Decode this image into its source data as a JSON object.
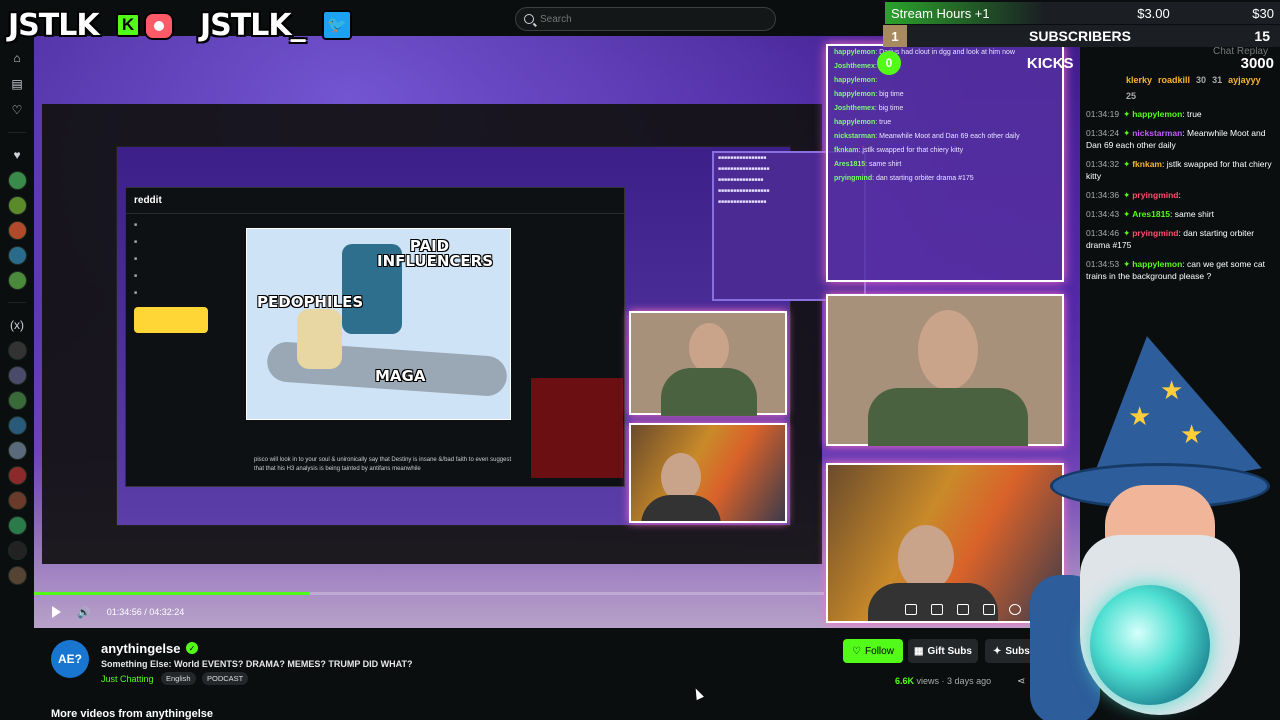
{
  "overlay": {
    "brand_left": "JSTLK",
    "brand_kick_letter": "K",
    "brand_right": "JSTLK_",
    "stream_hours_label": "Stream Hours +1",
    "stream_amount": "$3.00",
    "stream_goal": "$30",
    "subscribers_rank": "1",
    "subscribers_label": "SUBSCRIBERS",
    "subscribers_value": "15",
    "kicks_rank": "0",
    "kicks_label": "KICKS",
    "kicks_value": "3000"
  },
  "search": {
    "placeholder": "Search"
  },
  "sidebar": {
    "icons": [
      "home-icon",
      "browse-icon",
      "following-icon",
      "heart-icon"
    ],
    "avatars": [
      "a1",
      "a2",
      "a3",
      "a4",
      "a5",
      "a6",
      "a7",
      "a8",
      "a9",
      "a10",
      "a11",
      "a12",
      "a13",
      "a14",
      "a15",
      "a16"
    ]
  },
  "embedded": {
    "reddit_logo": "reddit",
    "meme_labels": [
      "PAID INFLUENCERS",
      "PEDOPHILES",
      "MAGA"
    ],
    "caption": "pisco will look in to your soul & unironically say that Destiny is insane &/bad faith to even suggest that that his H3 analysis is being tainted by antifans meanwhile"
  },
  "stream_chat": [
    {
      "user": "happylemon",
      "text": "Darius had clout in dgg and look at him now"
    },
    {
      "user": "Joshthemex",
      "text": ""
    },
    {
      "user": "happylemon",
      "text": ""
    },
    {
      "user": "happylemon",
      "text": "big time"
    },
    {
      "user": "Joshthemex",
      "text": "big time"
    },
    {
      "user": "happylemon",
      "text": "true"
    },
    {
      "user": "nickstarman",
      "text": "Meanwhile Moot and Dan 69 each other daily"
    },
    {
      "user": "fknkam",
      "text": "jstlk swapped for that chiery kitty"
    },
    {
      "user": "Ares1815",
      "text": "same shirt"
    },
    {
      "user": "pryingmind",
      "text": "dan starting orbiter drama #175"
    }
  ],
  "player": {
    "current_time": "01:34:56",
    "duration": "04:32:24",
    "progress_pct": 34.9
  },
  "right_chat": {
    "header": "Chat Replay",
    "leaders": [
      {
        "rank": "1",
        "name": "klerky",
        "name2": "roadkill",
        "n": "30"
      },
      {
        "rank": "",
        "name": "",
        "name2": "ayjayyy",
        "n": "25",
        "n1": "31"
      }
    ],
    "messages": [
      {
        "ts": "01:34:19",
        "user": "happylemon",
        "color": "#53fc18",
        "text": "true"
      },
      {
        "ts": "01:34:24",
        "user": "nickstarman",
        "color": "#c35bff",
        "text": "Meanwhile Moot and Dan 69 each other daily"
      },
      {
        "ts": "01:34:32",
        "user": "fknkam",
        "color": "#f6b42f",
        "text": "jstlk swapped for that chiery kitty"
      },
      {
        "ts": "01:34:36",
        "user": "pryingmind",
        "color": "#ff4d6d",
        "text": ""
      },
      {
        "ts": "01:34:43",
        "user": "Ares1815",
        "color": "#53fc18",
        "text": "same shirt"
      },
      {
        "ts": "01:34:46",
        "user": "pryingmind",
        "color": "#ff4d6d",
        "text": "dan starting orbiter drama #175"
      },
      {
        "ts": "01:34:53",
        "user": "happylemon",
        "color": "#53fc18",
        "text": "can we get some cat trains in the background please ?"
      }
    ]
  },
  "channel": {
    "avatar_text": "AE?",
    "name": "anythingelse",
    "title": "Something Else: World EVENTS? DRAMA? MEMES? TRUMP DID WHAT?",
    "category": "Just Chatting",
    "tags": [
      "English",
      "PODCAST"
    ],
    "follow_label": "Follow",
    "gift_label": "Gift Subs",
    "subscribe_label": "Subscri",
    "views": "6.6K",
    "views_suffix": "views",
    "age": "3 days ago",
    "more_videos": "More videos from anythingelse"
  }
}
